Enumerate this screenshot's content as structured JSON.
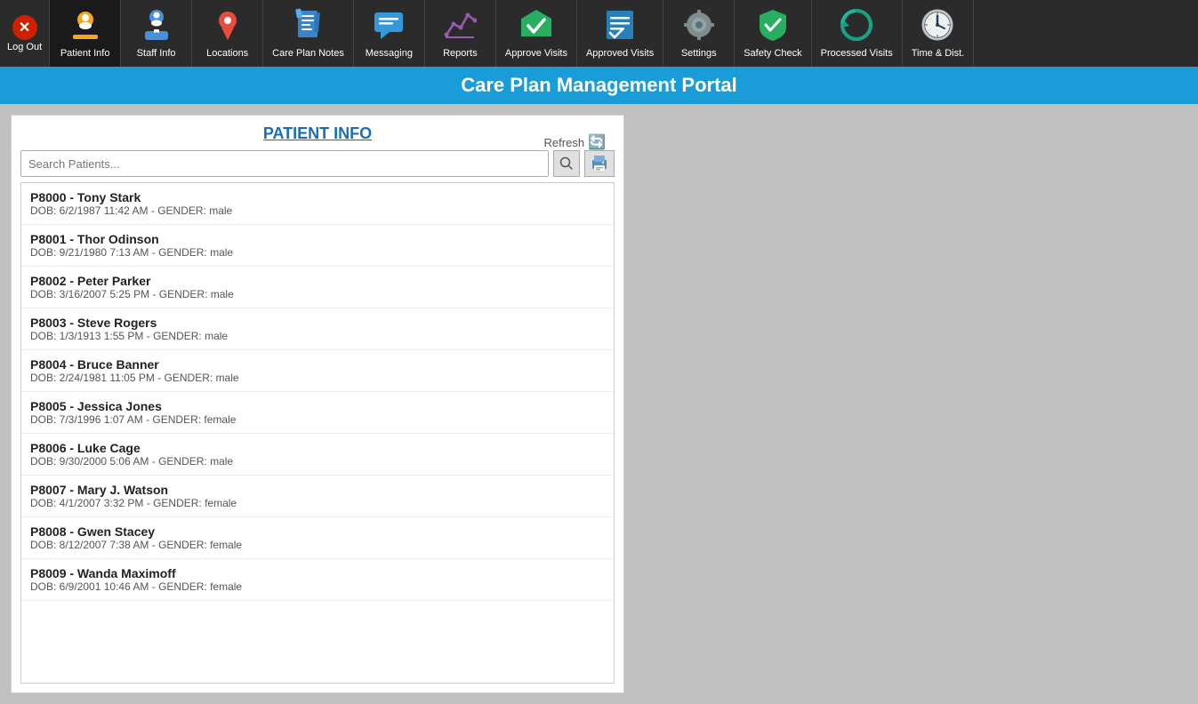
{
  "app": {
    "title": "Care Plan Management Portal"
  },
  "nav": {
    "items": [
      {
        "id": "patient-info",
        "label": "Patient Info",
        "icon": "👤",
        "active": true
      },
      {
        "id": "staff-info",
        "label": "Staff Info",
        "icon": "👩‍⚕️"
      },
      {
        "id": "locations",
        "label": "Locations",
        "icon": "📍"
      },
      {
        "id": "care-plan-notes",
        "label": "Care Plan Notes",
        "icon": "📋"
      },
      {
        "id": "messaging",
        "label": "Messaging",
        "icon": "💬"
      },
      {
        "id": "reports",
        "label": "Reports",
        "icon": "📊"
      },
      {
        "id": "approve-visits",
        "label": "Approve Visits",
        "icon": "✔️"
      },
      {
        "id": "approved-visits",
        "label": "Approved Visits",
        "icon": "📄"
      },
      {
        "id": "settings",
        "label": "Settings",
        "icon": "⚙️"
      },
      {
        "id": "safety-check",
        "label": "Safety Check",
        "icon": "🛡️"
      },
      {
        "id": "processed-visits",
        "label": "Processed Visits",
        "icon": "🔄"
      },
      {
        "id": "time-dist",
        "label": "Time & Dist.",
        "icon": "🕐"
      }
    ],
    "logout_label": "Log Out"
  },
  "patient_info": {
    "title": "PATIENT INFO",
    "search_placeholder": "Search Patients...",
    "refresh_label": "Refresh",
    "patients": [
      {
        "id": "P8000",
        "name": "Tony Stark",
        "dob": "6/2/1987 11:42 AM",
        "gender": "male"
      },
      {
        "id": "P8001",
        "name": "Thor Odinson",
        "dob": "9/21/1980 7:13 AM",
        "gender": "male"
      },
      {
        "id": "P8002",
        "name": "Peter Parker",
        "dob": "3/16/2007 5:25 PM",
        "gender": "male"
      },
      {
        "id": "P8003",
        "name": "Steve Rogers",
        "dob": "1/3/1913 1:55 PM",
        "gender": "male"
      },
      {
        "id": "P8004",
        "name": "Bruce Banner",
        "dob": "2/24/1981 11:05 PM",
        "gender": "male"
      },
      {
        "id": "P8005",
        "name": "Jessica Jones",
        "dob": "7/3/1996 1:07 AM",
        "gender": "female"
      },
      {
        "id": "P8006",
        "name": "Luke Cage",
        "dob": "9/30/2000 5:06 AM",
        "gender": "male"
      },
      {
        "id": "P8007",
        "name": "Mary J. Watson",
        "dob": "4/1/2007 3:32 PM",
        "gender": "female"
      },
      {
        "id": "P8008",
        "name": "Gwen Stacey",
        "dob": "8/12/2007 7:38 AM",
        "gender": "female"
      },
      {
        "id": "P8009",
        "name": "Wanda Maximoff",
        "dob": "6/9/2001 10:46 AM",
        "gender": "female"
      }
    ]
  }
}
